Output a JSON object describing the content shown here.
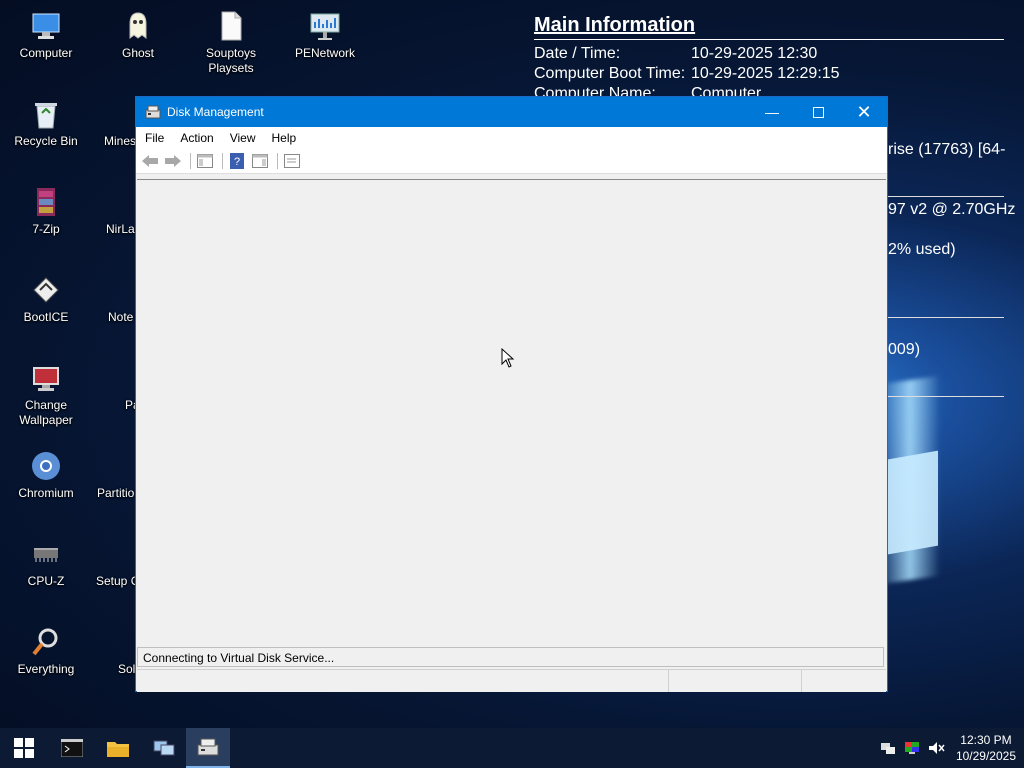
{
  "desktop_icons": {
    "col1": [
      "Computer",
      "Recycle Bin",
      "7-Zip",
      "BootICE",
      "Change\nWallpaper",
      "Chromium",
      "CPU-Z",
      "Everything"
    ],
    "col2": [
      "Ghost",
      "Mines",
      "NirLa",
      "Note",
      "Pa",
      "Partitio",
      "Setup C",
      "Sol"
    ],
    "col3": [
      "Souptoys\nPlaysets"
    ],
    "col4": [
      "PENetwork"
    ]
  },
  "info_panel": {
    "heading": "Main Information",
    "rows": [
      {
        "k": "Date / Time:",
        "v": "10-29-2025 12:30"
      },
      {
        "k": "Computer Boot Time:",
        "v": "10-29-2025 12:29:15"
      },
      {
        "k": "Computer Name:",
        "v": "Computer"
      }
    ],
    "fragments": [
      "rise (17763) [64-",
      "97 v2 @ 2.70GHz",
      "2% used)",
      "009)"
    ]
  },
  "window": {
    "title": "Disk Management",
    "menu": [
      "File",
      "Action",
      "View",
      "Help"
    ],
    "status_text": "Connecting to Virtual Disk Service..."
  },
  "taskbar": {
    "time": "12:30 PM",
    "date": "10/29/2025"
  }
}
